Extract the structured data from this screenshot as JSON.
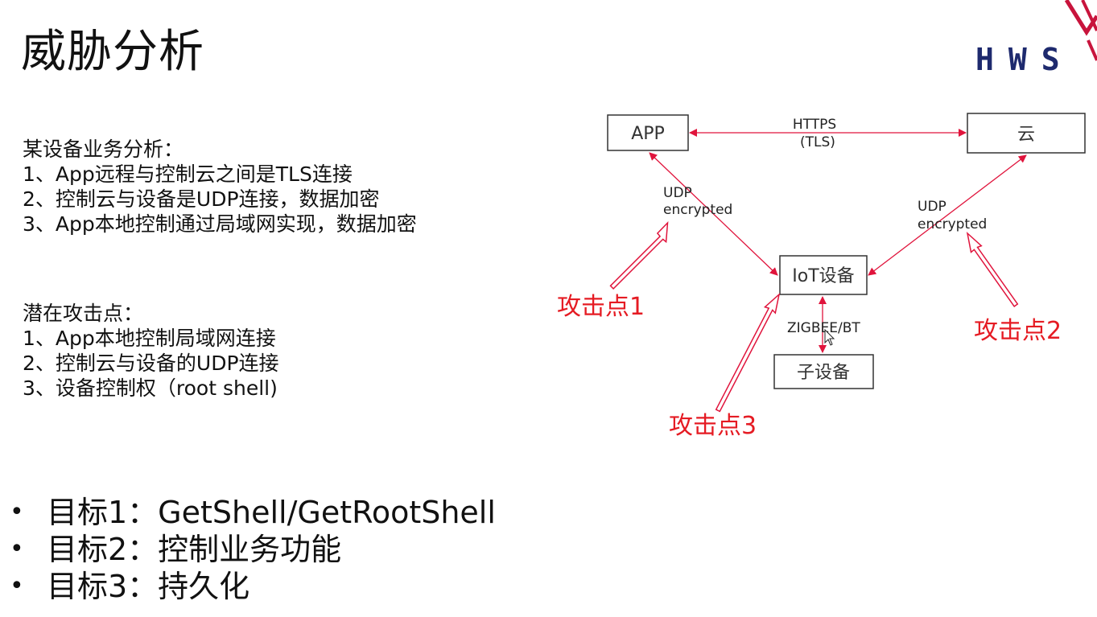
{
  "title": "威胁分析",
  "logo_text": "HWS",
  "analysis": {
    "heading": "某设备业务分析：",
    "items": [
      "1、App远程与控制云之间是TLS连接",
      "2、控制云与设备是UDP连接，数据加密",
      "3、App本地控制通过局域网实现，数据加密"
    ]
  },
  "attack_surface": {
    "heading": "潜在攻击点：",
    "items": [
      "1、App本地控制局域网连接",
      "2、控制云与设备的UDP连接",
      "3、设备控制权（root shell)"
    ]
  },
  "goals": [
    "目标1：GetShell/GetRootShell",
    "目标2：控制业务功能",
    "目标3：持久化"
  ],
  "diagram": {
    "nodes": {
      "app": "APP",
      "cloud": "云",
      "iot": "IoT设备",
      "sub": "子设备"
    },
    "links": {
      "https": "HTTPS",
      "tls": "(TLS)",
      "udp_left_1": "UDP",
      "udp_left_2": "encrypted",
      "udp_right_1": "UDP",
      "udp_right_2": "encrypted",
      "zigbee": "ZIGBEE/BT"
    },
    "attack_points": {
      "p1": "攻击点1",
      "p2": "攻击点2",
      "p3": "攻击点3"
    },
    "colors": {
      "arrow": "#e0143c",
      "attack": "#e51b23",
      "box_border": "#333333"
    }
  }
}
